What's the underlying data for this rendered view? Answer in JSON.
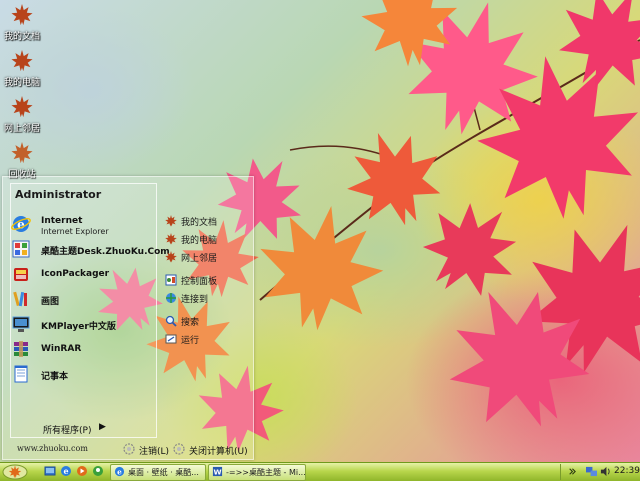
{
  "desktop": {
    "icons": [
      {
        "label": "我的文档",
        "icon": "maple-leaf-icon"
      },
      {
        "label": "我的电脑",
        "icon": "maple-leaf-icon"
      },
      {
        "label": "网上邻居",
        "icon": "maple-leaf-icon"
      },
      {
        "label": "回收站",
        "icon": "maple-leaf-icon"
      }
    ]
  },
  "start_menu": {
    "user": "Administrator",
    "programs": [
      {
        "title": "Internet",
        "subtitle": "Internet Explorer",
        "icon": "ie-icon"
      },
      {
        "title": "桌酷主题Desk.ZhuoKu.Com",
        "icon": "theme-icon"
      },
      {
        "title": "IconPackager",
        "icon": "iconpackager-icon"
      },
      {
        "title": "画图",
        "icon": "paint-icon"
      },
      {
        "title": "KMPlayer中文版",
        "icon": "kmplayer-icon"
      },
      {
        "title": "WinRAR",
        "icon": "winrar-icon"
      },
      {
        "title": "记事本",
        "icon": "notepad-icon"
      }
    ],
    "all_programs": "所有程序(P)",
    "all_programs_arrow": "▶",
    "places": [
      {
        "label": "我的文档",
        "icon": "maple-leaf-icon"
      },
      {
        "label": "我的电脑",
        "icon": "maple-leaf-icon"
      },
      {
        "label": "网上邻居",
        "icon": "maple-leaf-icon"
      },
      {
        "label": "控制面板",
        "icon": "control-panel-icon"
      },
      {
        "label": "连接到",
        "icon": "connect-icon"
      },
      {
        "label": "搜索",
        "icon": "search-icon"
      },
      {
        "label": "运行",
        "icon": "run-icon"
      }
    ],
    "site_url": "www.zhuoku.com",
    "logoff": "注销(L)",
    "shutdown": "关闭计算机(U)"
  },
  "taskbar": {
    "tasks": [
      {
        "label": "桌面 · 壁纸 · 桌酷...",
        "icon": "ie-icon"
      },
      {
        "label": "-=>>桌酷主题 - Mi...",
        "icon": "word-icon"
      }
    ],
    "clock": "22:39"
  },
  "colors": {
    "taskbar": "#a8c83c",
    "leaf_red": "#e8345a",
    "leaf_orange": "#f07a2a"
  }
}
